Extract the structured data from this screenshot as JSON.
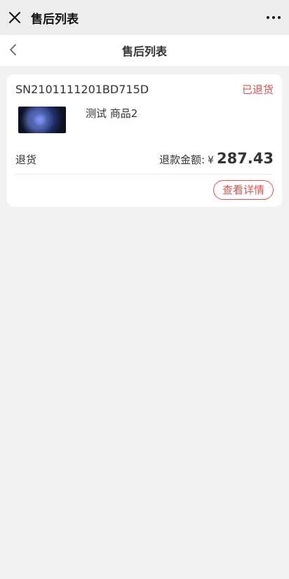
{
  "topbar": {
    "title": "售后列表"
  },
  "navbar": {
    "title": "售后列表"
  },
  "order": {
    "sn": "SN2101111201BD715D",
    "status": "已退货",
    "product_name": "测试 商品2",
    "return_type": "退货",
    "refund_label": "退款金额:",
    "currency": "¥",
    "amount": "287.43",
    "detail_button": "查看详情"
  },
  "icons": {
    "close": "close-icon",
    "more": "more-icon",
    "back": "back-icon"
  },
  "colors": {
    "accent": "#d9534f",
    "background": "#f2f2f2"
  }
}
